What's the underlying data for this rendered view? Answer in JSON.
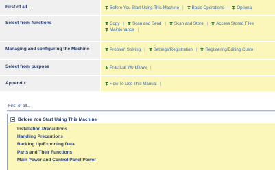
{
  "nav": [
    {
      "heading": "First of all...",
      "links": [
        "Before You Start Using This Machine",
        "Basic Operations",
        "Optional"
      ]
    },
    {
      "heading": "Select from functions",
      "links": [
        "Copy",
        "Scan and Send",
        "Scan and Store",
        "Access Stored Files",
        "Maintenance"
      ]
    },
    {
      "heading": "Managing and configuring the Machine",
      "links": [
        "Problem Solving",
        "Settings/Registration",
        "Registering/Editing Custo"
      ]
    },
    {
      "heading": "Select from purpose",
      "links": [
        "Practical Workflows"
      ]
    },
    {
      "heading": "Appendix",
      "links": [
        "How To Use This Manual"
      ]
    }
  ],
  "section": {
    "title": "First of all...",
    "box_title": "Before You Start Using This Machine",
    "items": [
      "Installation Precautions",
      "Handling Precautions",
      "Backing Up/Exporting Data",
      "Parts and Their Functions",
      "Main Power and Control Panel Power"
    ]
  },
  "colors": {
    "link": "#3a6ab5",
    "heading": "#233a6e",
    "highlight": "#fbf6b9"
  },
  "icons": {
    "link": "download-arrow-icon",
    "collapse": "minus-box-icon"
  }
}
